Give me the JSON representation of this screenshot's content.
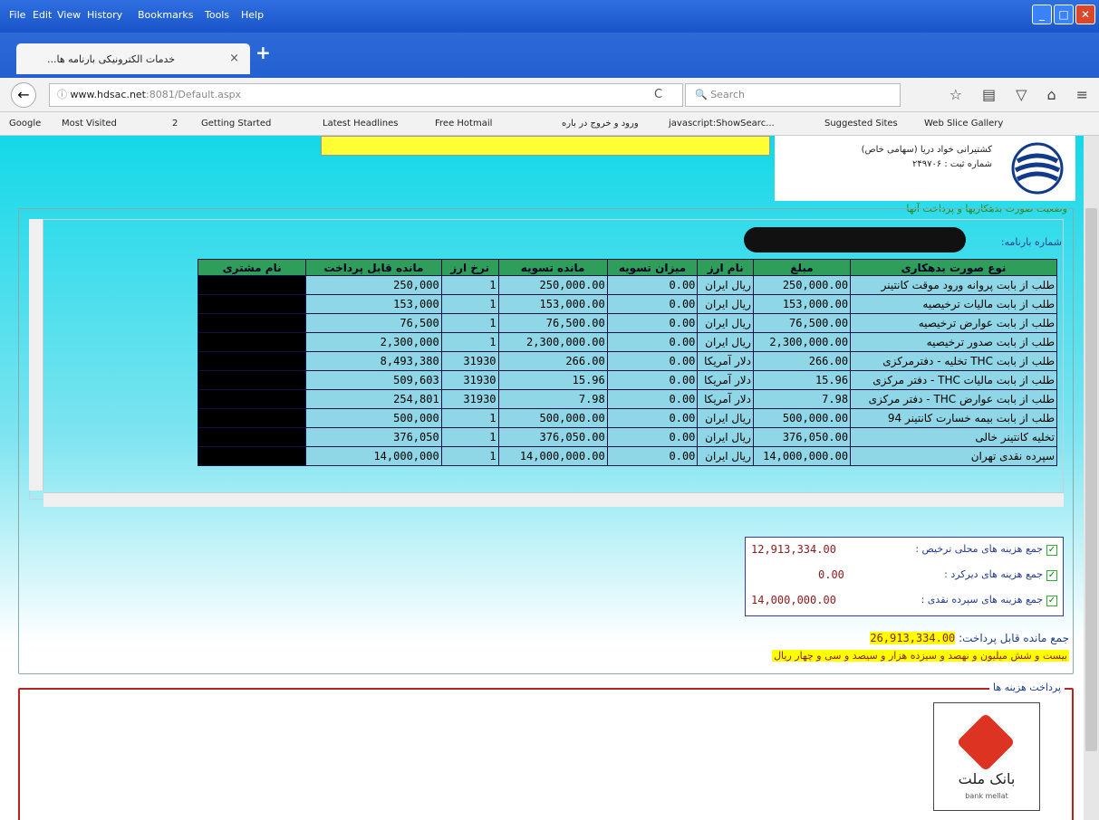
{
  "menu": [
    "File",
    "Edit",
    "View",
    "History",
    "Bookmarks",
    "Tools",
    "Help"
  ],
  "tab": {
    "title": "...خدمات الکترونیکی بارنامه ها",
    "close": "×",
    "new": "+"
  },
  "nav": {
    "url_host": "www.hdsac.net",
    "url_rest": ":8081/Default.aspx",
    "search_placeholder": "Search"
  },
  "bookmarks": [
    "Google",
    "Most Visited",
    "2",
    "Getting Started",
    "Latest Headlines",
    "Free Hotmail",
    "ورود و خروج در باره",
    "javascript:ShowSearc...",
    "Suggested Sites",
    "Web Slice Gallery"
  ],
  "header": {
    "line1": "کشتیرانی خواد دریا (سهامی خاص)",
    "line2": "شماره ثبت : ۲۴۹۷۰۶"
  },
  "section_label": "وضعیت صورت بدهکاریها و پرداخت آنها",
  "bl_label": "شماره بارنامه:",
  "table": {
    "headers": [
      "نوع صورت بدهکاری",
      "مبلغ",
      "نام ارز",
      "میزان تسویه",
      "مانده تسویه",
      "نرخ ارز",
      "مانده قابل پرداخت",
      "نام مشتری"
    ],
    "rows": [
      [
        "طلب از بابت پروانه ورود موقت کانتینر",
        "250,000.00",
        "ریال ایران",
        "0.00",
        "250,000.00",
        "1",
        "250,000"
      ],
      [
        "طلب از بابت مالیات ترخیصیه",
        "153,000.00",
        "ریال ایران",
        "0.00",
        "153,000.00",
        "1",
        "153,000"
      ],
      [
        "طلب از بابت عوارض ترخیصیه",
        "76,500.00",
        "ریال ایران",
        "0.00",
        "76,500.00",
        "1",
        "76,500"
      ],
      [
        "طلب از بابت صدور ترخیصیه",
        "2,300,000.00",
        "ریال ایران",
        "0.00",
        "2,300,000.00",
        "1",
        "2,300,000"
      ],
      [
        "طلب از بابت THC تخلیه - دفترمرکزی",
        "266.00",
        "دلار آمریکا",
        "0.00",
        "266.00",
        "31930",
        "8,493,380"
      ],
      [
        "طلب از بابت مالیات THC - دفتر مرکزی",
        "15.96",
        "دلار آمریکا",
        "0.00",
        "15.96",
        "31930",
        "509,603"
      ],
      [
        "طلب از بابت عوارض THC - دفتر مرکزی",
        "7.98",
        "دلار آمریکا",
        "0.00",
        "7.98",
        "31930",
        "254,801"
      ],
      [
        "طلب از بابت بیمه خسارت کانتینر 94",
        "500,000.00",
        "ریال ایران",
        "0.00",
        "500,000.00",
        "1",
        "500,000"
      ],
      [
        "تخلیه کانتینر خالی",
        "376,050.00",
        "ریال ایران",
        "0.00",
        "376,050.00",
        "1",
        "376,050"
      ],
      [
        "سپرده نقدی تهران",
        "14,000,000.00",
        "ریال ایران",
        "0.00",
        "14,000,000.00",
        "1",
        "14,000,000"
      ]
    ]
  },
  "totals": {
    "local_label": "جمع هزینه های محلی ترخیص :",
    "local_value": "12,913,334.00",
    "demurrage_label": "جمع هزینه های دیرکرد :",
    "demurrage_value": "0.00",
    "deposit_label": "جمع هزینه های سپرده نقدی :",
    "deposit_value": "14,000,000.00"
  },
  "payable_label": "جمع مانده قابل پرداخت:",
  "payable_value": "26,913,334.00",
  "payable_words": "بیست و شش میلیون و نهصد و سیزده هزار و سیصد و سی و چهار ریال",
  "payment_section": "پرداخت هزینه ها",
  "bank": {
    "name_fa": "بانک ملت",
    "name_en": "bank mellat"
  }
}
